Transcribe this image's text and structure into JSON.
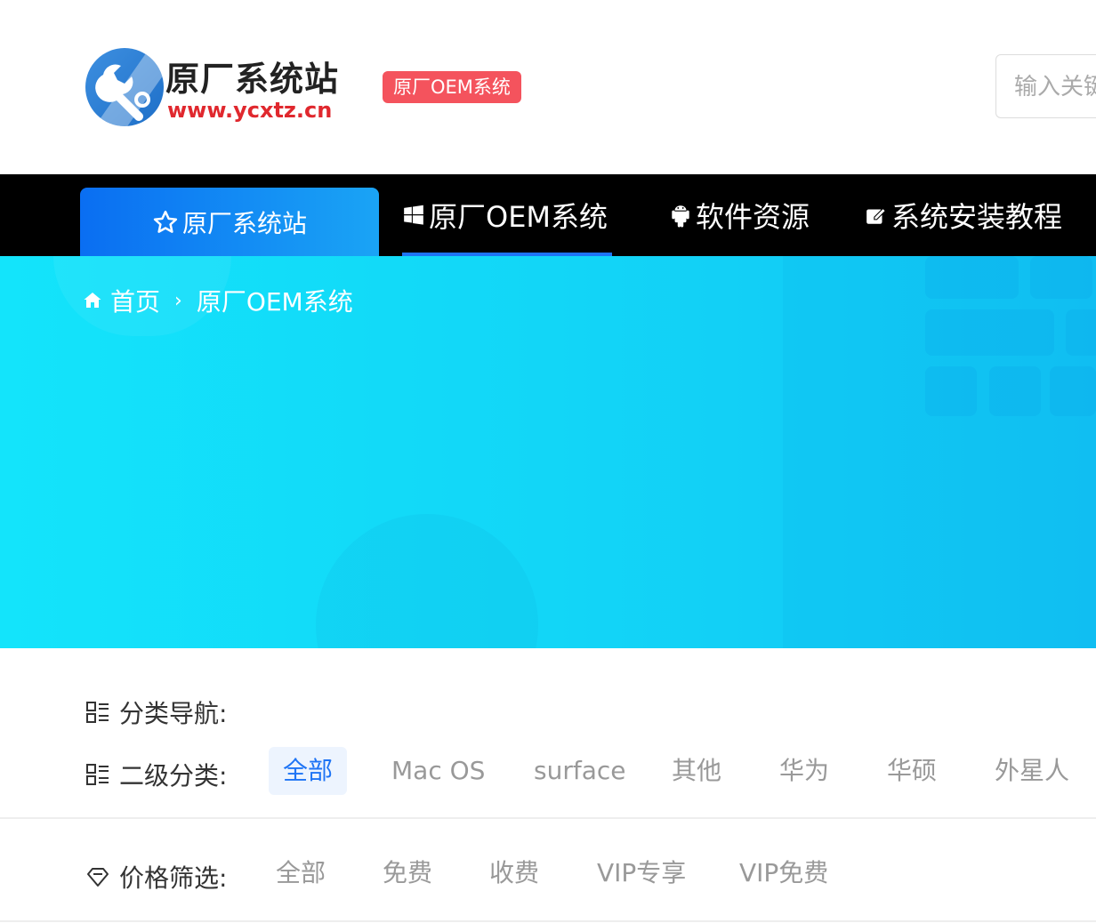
{
  "header": {
    "logo_title": "原厂系统站",
    "logo_url": "www.ycxtz.cn",
    "badge": "原厂OEM系统",
    "search_placeholder": "输入关键"
  },
  "nav": {
    "home": "原厂系统站",
    "oem": "原厂OEM系统",
    "software": "软件资源",
    "tutorial": "系统安装教程"
  },
  "breadcrumb": {
    "home": "首页",
    "separator": "›",
    "current": "原厂OEM系统"
  },
  "filters": {
    "category_label": "分类导航:",
    "subcategory_label": "二级分类:",
    "subcategories": [
      "全部",
      "Mac OS",
      "surface",
      "其他",
      "华为",
      "华硕",
      "外星人"
    ],
    "subcategory_selected": "全部",
    "price_label": "价格筛选:",
    "prices": [
      "全部",
      "免费",
      "收费",
      "VIP专享",
      "VIP免费"
    ]
  },
  "colors": {
    "accent": "#1e74f5",
    "badge": "#f4535d",
    "banner": "#13e4fb",
    "nav_bg": "#000000"
  }
}
